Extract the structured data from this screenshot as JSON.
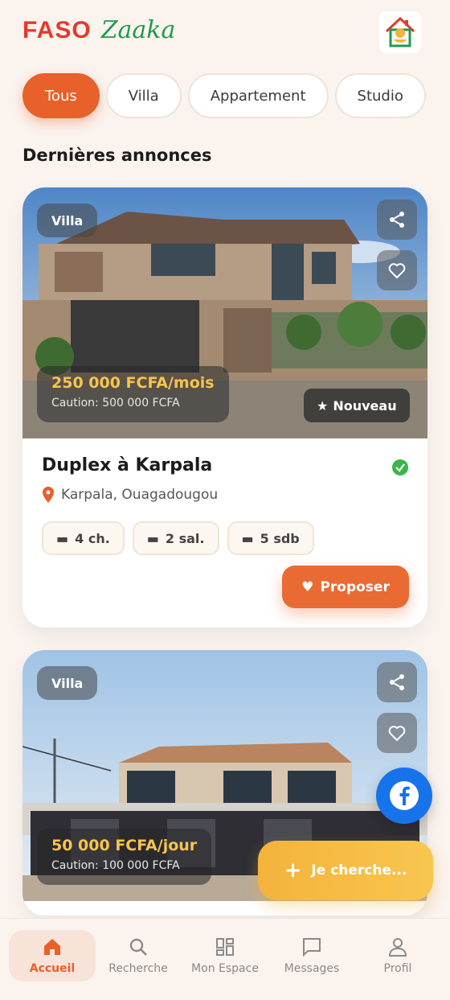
{
  "brand": {
    "part1": "FASO",
    "part2": "Zaaka"
  },
  "filters": [
    "Tous",
    "Villa",
    "Appartement",
    "Studio"
  ],
  "section_title": "Dernières annonces",
  "listings": [
    {
      "type": "Villa",
      "price": "250 000 FCFA/mois",
      "caution": "Caution: 500 000 FCFA",
      "badge": "Nouveau",
      "title": "Duplex à Karpala",
      "location": "Karpala, Ouagadougou",
      "features": [
        "4 ch.",
        "2 sal.",
        "5 sdb"
      ],
      "action": "Proposer"
    },
    {
      "type": "Villa",
      "price": "50 000 FCFA/jour",
      "caution": "Caution: 100 000 FCFA"
    }
  ],
  "search_fab": "Je cherche...",
  "nav": [
    "Accueil",
    "Recherche",
    "Mon Espace",
    "Messages",
    "Profil"
  ],
  "colors": {
    "accent": "#e8602a",
    "price": "#f7c44e",
    "brand_red": "#e4392c",
    "brand_green": "#1f9a4f",
    "facebook": "#1773ea"
  }
}
